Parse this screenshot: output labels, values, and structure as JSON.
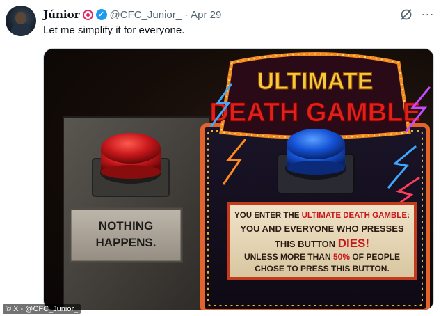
{
  "tweet": {
    "author_name": "Júnior",
    "author_handle": "@CFC_Junior_",
    "separator": "·",
    "date": "Apr 29",
    "text": "Let me simplify it for everyone.",
    "verified_icon": "check-badge-icon",
    "menu_icon": "more-icon"
  },
  "media": {
    "marquee_top": "ULTIMATE",
    "marquee_bottom": "DEATH GAMBLE",
    "left_button_color": "#c8181c",
    "right_button_color": "#1452d6",
    "left_plaque_line1": "NOTHING",
    "left_plaque_line2": "HAPPENS.",
    "right_plaque": {
      "line1_prefix": "YOU ENTER THE ",
      "line1_highlight": "ULTIMATE DEATH GAMBLE",
      "line1_suffix": ":",
      "line2": "YOU AND EVERYONE WHO PRESSES",
      "line3_prefix": "THIS BUTTON ",
      "line3_highlight": "DIES!",
      "line4_prefix": "UNLESS MORE THAN ",
      "line4_highlight": "50%",
      "line4_suffix": " OF PEOPLE",
      "line5": "CHOSE TO PRESS THIS BUTTON."
    }
  },
  "watermark": "© X - @CFC_Junior_"
}
